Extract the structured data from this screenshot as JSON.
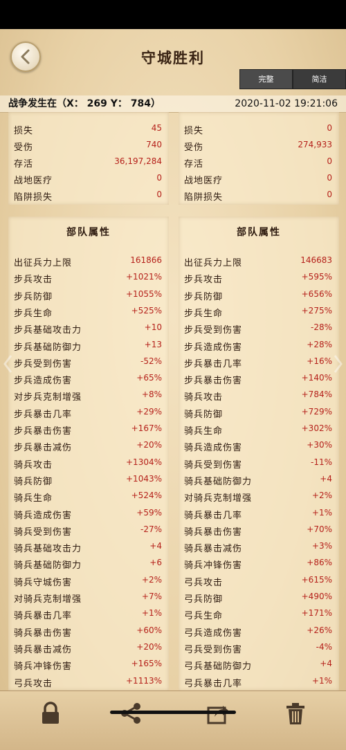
{
  "header": {
    "title": "守城胜利",
    "toggle": {
      "full": "完整",
      "simple": "简洁"
    }
  },
  "battle": {
    "location": "战争发生在（X： 269 Y： 784）",
    "datetime": "2020-11-02   19:21:06"
  },
  "losses": {
    "left": [
      {
        "label": "损失",
        "value": "45"
      },
      {
        "label": "受伤",
        "value": "740"
      },
      {
        "label": "存活",
        "value": "36,197,284"
      },
      {
        "label": "战地医疗",
        "value": "0"
      },
      {
        "label": "陷阱损失",
        "value": "0"
      }
    ],
    "right": [
      {
        "label": "损失",
        "value": "0"
      },
      {
        "label": "受伤",
        "value": "274,933"
      },
      {
        "label": "存活",
        "value": "0"
      },
      {
        "label": "战地医疗",
        "value": "0"
      },
      {
        "label": "陷阱损失",
        "value": "0"
      }
    ]
  },
  "attributes": {
    "left": {
      "title": "部队属性",
      "rows": [
        {
          "label": "出征兵力上限",
          "value": "161866"
        },
        {
          "label": "步兵攻击",
          "value": "+1021%"
        },
        {
          "label": "步兵防御",
          "value": "+1055%"
        },
        {
          "label": "步兵生命",
          "value": "+525%"
        },
        {
          "label": "步兵基础攻击力",
          "value": "+10"
        },
        {
          "label": "步兵基础防御力",
          "value": "+13"
        },
        {
          "label": "步兵受到伤害",
          "value": "-52%"
        },
        {
          "label": "步兵造成伤害",
          "value": "+65%"
        },
        {
          "label": "对步兵克制增强",
          "value": "+8%"
        },
        {
          "label": "步兵暴击几率",
          "value": "+29%"
        },
        {
          "label": "步兵暴击伤害",
          "value": "+167%"
        },
        {
          "label": "步兵暴击减伤",
          "value": "+20%"
        },
        {
          "label": "骑兵攻击",
          "value": "+1304%"
        },
        {
          "label": "骑兵防御",
          "value": "+1043%"
        },
        {
          "label": "骑兵生命",
          "value": "+524%"
        },
        {
          "label": "骑兵造成伤害",
          "value": "+59%"
        },
        {
          "label": "骑兵受到伤害",
          "value": "-27%"
        },
        {
          "label": "骑兵基础攻击力",
          "value": "+4"
        },
        {
          "label": "骑兵基础防御力",
          "value": "+6"
        },
        {
          "label": "骑兵守城伤害",
          "value": "+2%"
        },
        {
          "label": "对骑兵克制增强",
          "value": "+7%"
        },
        {
          "label": "骑兵暴击几率",
          "value": "+1%"
        },
        {
          "label": "骑兵暴击伤害",
          "value": "+60%"
        },
        {
          "label": "骑兵暴击减伤",
          "value": "+20%"
        },
        {
          "label": "骑兵冲锋伤害",
          "value": "+165%"
        },
        {
          "label": "弓兵攻击",
          "value": "+1113%"
        }
      ]
    },
    "right": {
      "title": "部队属性",
      "rows": [
        {
          "label": "出征兵力上限",
          "value": "146683"
        },
        {
          "label": "步兵攻击",
          "value": "+595%"
        },
        {
          "label": "步兵防御",
          "value": "+656%"
        },
        {
          "label": "步兵生命",
          "value": "+275%"
        },
        {
          "label": "步兵受到伤害",
          "value": "-28%"
        },
        {
          "label": "步兵造成伤害",
          "value": "+28%"
        },
        {
          "label": "步兵暴击几率",
          "value": "+16%"
        },
        {
          "label": "步兵暴击伤害",
          "value": "+140%"
        },
        {
          "label": "骑兵攻击",
          "value": "+784%"
        },
        {
          "label": "骑兵防御",
          "value": "+729%"
        },
        {
          "label": "骑兵生命",
          "value": "+302%"
        },
        {
          "label": "骑兵造成伤害",
          "value": "+30%"
        },
        {
          "label": "骑兵受到伤害",
          "value": "-11%"
        },
        {
          "label": "骑兵基础防御力",
          "value": "+4"
        },
        {
          "label": "对骑兵克制增强",
          "value": "+2%"
        },
        {
          "label": "骑兵暴击几率",
          "value": "+1%"
        },
        {
          "label": "骑兵暴击伤害",
          "value": "+70%"
        },
        {
          "label": "骑兵暴击减伤",
          "value": "+3%"
        },
        {
          "label": "骑兵冲锋伤害",
          "value": "+86%"
        },
        {
          "label": "弓兵攻击",
          "value": "+615%"
        },
        {
          "label": "弓兵防御",
          "value": "+490%"
        },
        {
          "label": "弓兵生命",
          "value": "+171%"
        },
        {
          "label": "弓兵造成伤害",
          "value": "+26%"
        },
        {
          "label": "弓兵受到伤害",
          "value": "-4%"
        },
        {
          "label": "弓兵基础防御力",
          "value": "+4"
        },
        {
          "label": "弓兵暴击几率",
          "value": "+1%"
        }
      ]
    }
  },
  "toolbar": {
    "icons": [
      "lock-icon",
      "share-icon",
      "forward-icon",
      "trash-icon"
    ]
  },
  "colors": {
    "parchment": "#ecd7b0",
    "value_red": "#b5201a",
    "label_dark": "#2d1a0f"
  }
}
